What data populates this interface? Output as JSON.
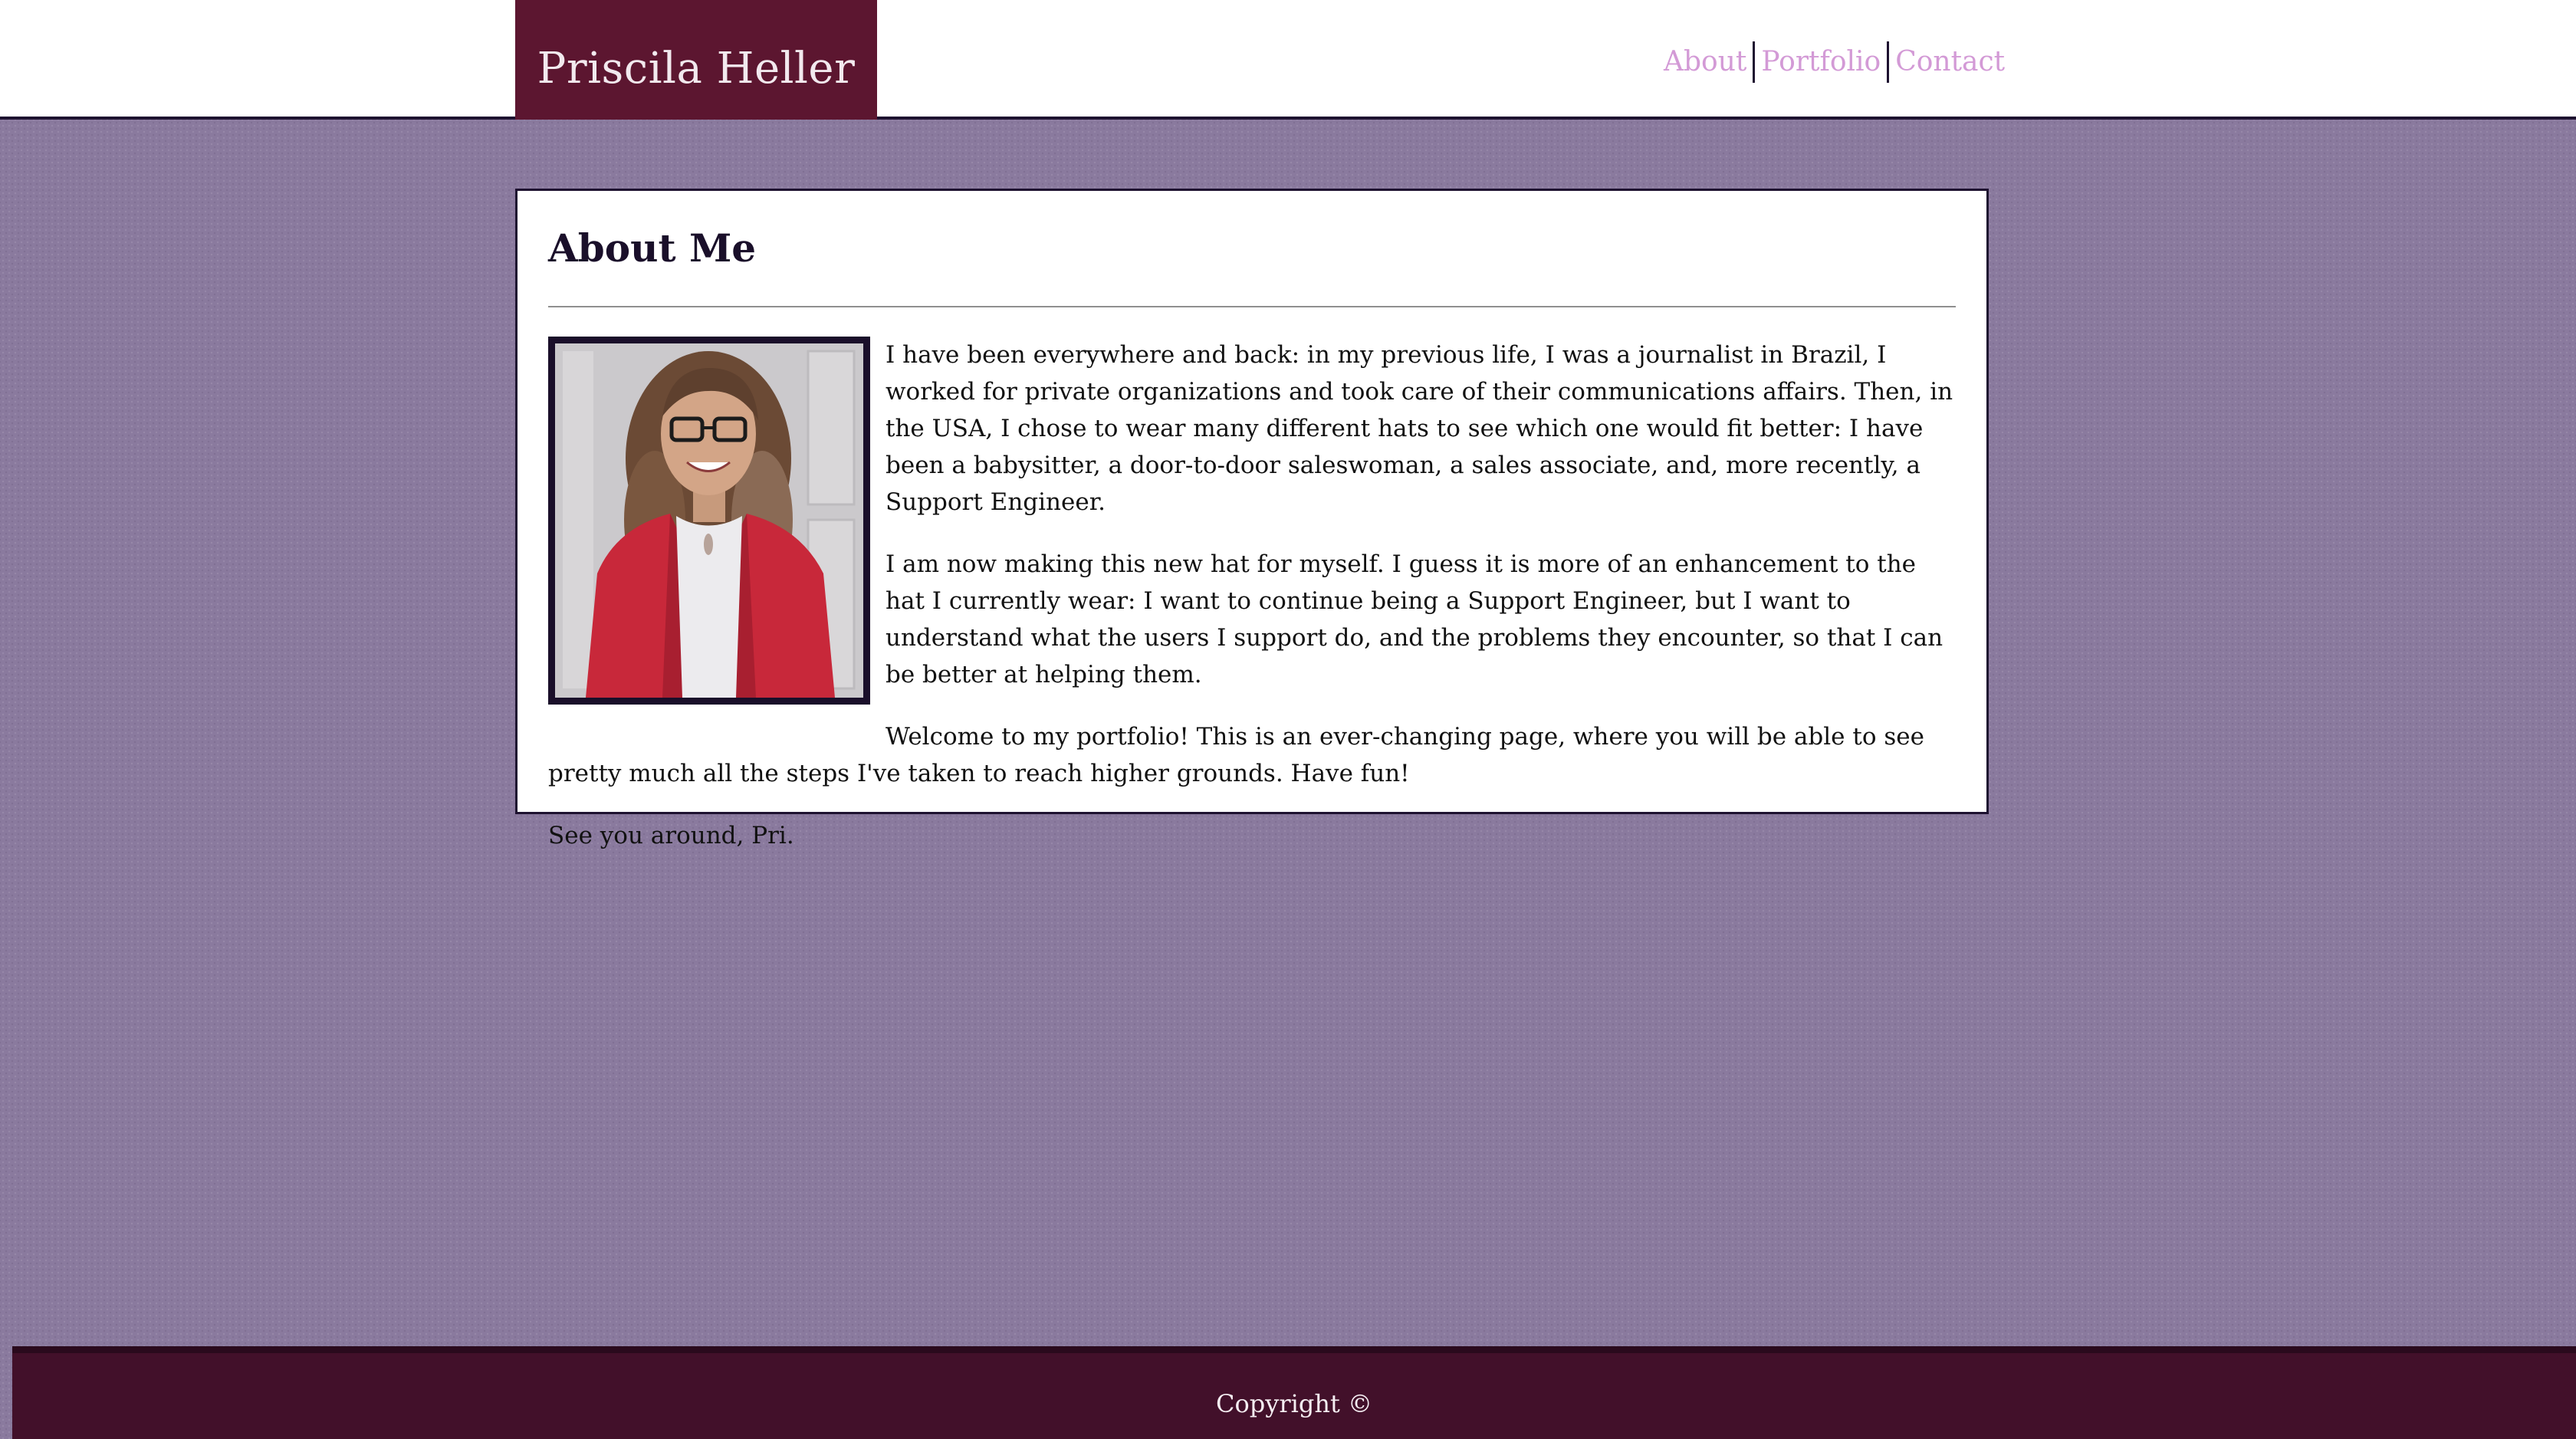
{
  "header": {
    "brand": "Priscila Heller",
    "nav": [
      {
        "label": "About"
      },
      {
        "label": "Portfolio"
      },
      {
        "label": "Contact"
      }
    ]
  },
  "about": {
    "title": "About Me",
    "paragraphs": [
      "I have been everywhere and back: in my previous life, I was a journalist in Brazil, I worked for private organizations and took care of their communications affairs. Then, in the USA, I chose to wear many different hats to see which one would fit better: I have been a babysitter, a door-to-door saleswoman, a sales associate, and, more recently, a Support Engineer.",
      "I am now making this new hat for myself. I guess it is more of an enhancement to the hat I currently wear: I want to continue being a Support Engineer, but I want to understand what the users I support do, and the problems they encounter, so that I can be better at helping them.",
      "Welcome to my portfolio! This is an ever-changing page, where you will be able to see pretty much all the steps I've taken to reach higher grounds. Have fun!"
    ],
    "signoff": "See you around, Pri."
  },
  "footer": {
    "copyright": "Copyright ©"
  },
  "colors": {
    "brand_bg": "#5c1630",
    "nav_link": "#d39ad6",
    "page_bg": "#8a7a9e",
    "footer_bg": "#42102a",
    "border": "#1e1230"
  }
}
